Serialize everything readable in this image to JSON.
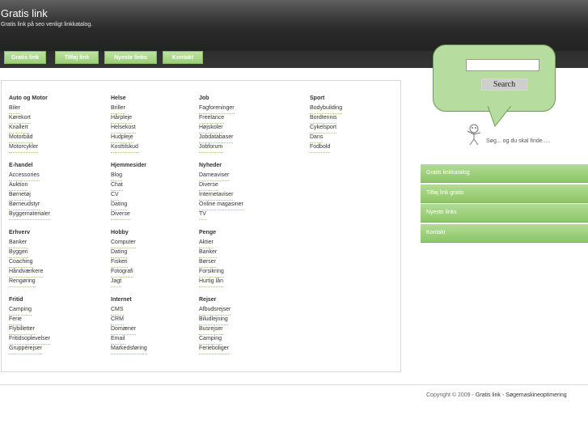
{
  "header": {
    "title": "Gratis link",
    "subtitle": "Gratis link på seo venligt linkkatalog."
  },
  "nav": [
    "Gratis link",
    "Tilføj link",
    "Nyeste links",
    "Kontakt"
  ],
  "categories": [
    {
      "title": "Auto og Motor",
      "links": [
        "Biler",
        "Kørekort",
        "Knallert",
        "Motorbåd",
        "Motorcykler"
      ]
    },
    {
      "title": "Helse",
      "links": [
        "Briller",
        "Hårpleje",
        "Helsekost",
        "Hudpleje",
        "Kosttilskud"
      ]
    },
    {
      "title": "Job",
      "links": [
        "Fagforeninger",
        "Freelance",
        "Højskoler",
        "Jobdatabaser",
        "Jobforum"
      ]
    },
    {
      "title": "Sport",
      "links": [
        "Bodybuilding",
        "Bordtennis",
        "Cykelsport",
        "Dans",
        "Fodbold"
      ]
    },
    {
      "title": "E-handel",
      "links": [
        "Accessories",
        "Auktion",
        "Børnetøj",
        "Børneudstyr",
        "Byggematerialer"
      ]
    },
    {
      "title": "Hjemmesider",
      "links": [
        "Blog",
        "Chat",
        "CV",
        "Dating",
        "Diverse"
      ]
    },
    {
      "title": "Nyheder",
      "links": [
        "Dameaviser",
        "Diverse",
        "Internetaviser",
        "Online magasiner",
        "TV"
      ]
    },
    {
      "title": "Erhverv",
      "links": [
        "Banker",
        "Byggeri",
        "Coaching",
        "Håndværkere",
        "Rengøring"
      ]
    },
    {
      "title": "Hobby",
      "links": [
        "Computer",
        "Dating",
        "Fiskeri",
        "Fotografi",
        "Jagt"
      ]
    },
    {
      "title": "Penge",
      "links": [
        "Aktier",
        "Banker",
        "Børser",
        "Forsikring",
        "Hurtig lån"
      ]
    },
    {
      "title": "Fritid",
      "links": [
        "Camping",
        "Ferie",
        "Flybilletter",
        "Fritidsoplevelser",
        "Gruppérejser"
      ]
    },
    {
      "title": "Internet",
      "links": [
        "CMS",
        "CRM",
        "Domæner",
        "Email",
        "Markedsføring"
      ]
    },
    {
      "title": "Rejser",
      "links": [
        "Afbudsrejser",
        "Biludlejning",
        "Busrejser",
        "Camping",
        "Ferieboliger"
      ]
    }
  ],
  "search": {
    "placeholder": "",
    "button_label": "Search",
    "slogan": "Søg... og du skal finde....."
  },
  "sidebar": [
    "Gratis linkkatalog",
    "Tilføj link gratis",
    "Nyeste links",
    "Kontakt"
  ],
  "footer": {
    "copyright": "Copyright © 2009 - ",
    "link_site": "Gratis link",
    "separator": " - ",
    "link_seo": "Søgemaskineoptimering"
  },
  "colors": {
    "accent_green": "#9dd07a",
    "header_dark": "#2a2a2a",
    "link_underline": "#9cc781"
  },
  "icons": {
    "mascot": "stick-figure-icon"
  }
}
